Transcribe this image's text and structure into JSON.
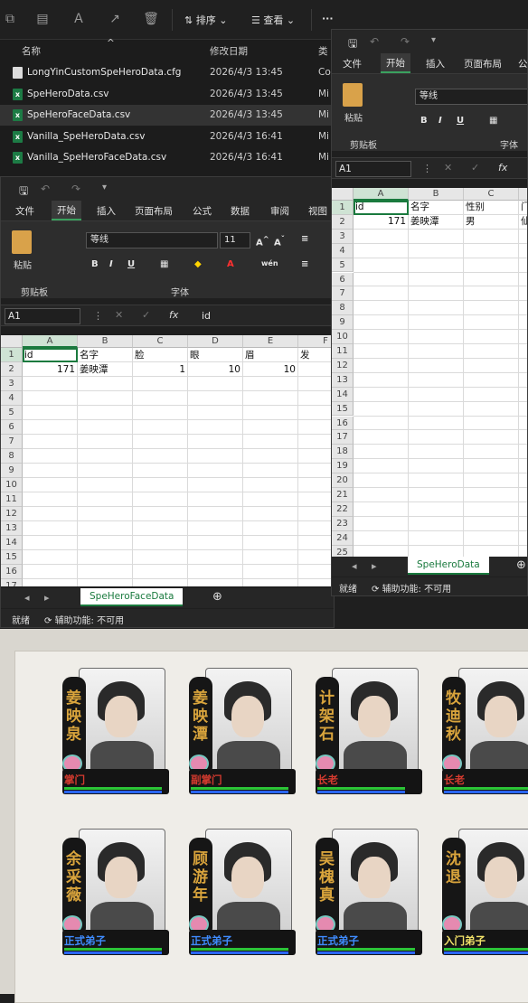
{
  "explorer": {
    "toolbar": {
      "sort_label": "排序",
      "view_label": "查看",
      "more_label": "···"
    },
    "columns": {
      "name": "名称",
      "date": "修改日期",
      "type": "类"
    },
    "files": [
      {
        "name": "LongYinCustomSpeHeroData.cfg",
        "date": "2026/4/3 13:45",
        "type": "Co",
        "kind": "cfg"
      },
      {
        "name": "SpeHeroData.csv",
        "date": "2026/4/3 13:45",
        "type": "Mi",
        "kind": "csv"
      },
      {
        "name": "SpeHeroFaceData.csv",
        "date": "2026/4/3 13:45",
        "type": "Mi",
        "kind": "csv",
        "selected": true
      },
      {
        "name": "Vanilla_SpeHeroData.csv",
        "date": "2026/4/3 16:41",
        "type": "Mi",
        "kind": "csv"
      },
      {
        "name": "Vanilla_SpeHeroFaceData.csv",
        "date": "2026/4/3 16:41",
        "type": "Mi",
        "kind": "csv"
      }
    ]
  },
  "excel_face": {
    "tabs": [
      "文件",
      "开始",
      "插入",
      "页面布局",
      "公式",
      "数据",
      "审阅",
      "视图"
    ],
    "active_tab": "开始",
    "ribbon": {
      "paste": "粘贴",
      "clipboard": "剪贴板",
      "font_name": "等线",
      "font_size": "11",
      "font_group": "字体"
    },
    "namebox": "A1",
    "formula": "id",
    "columns": [
      "A",
      "B",
      "C",
      "D",
      "E",
      "F"
    ],
    "rows": [
      "1",
      "2",
      "3",
      "4",
      "5",
      "6",
      "7",
      "8",
      "9",
      "10",
      "11",
      "12",
      "13",
      "14",
      "15",
      "16",
      "17"
    ],
    "cells": {
      "A1": "id",
      "B1": "名字",
      "C1": "脸",
      "D1": "眼",
      "E1": "眉",
      "F1": "发",
      "A2": "171",
      "B2": "姜映潭",
      "C2": "1",
      "D2": "10",
      "E2": "10"
    },
    "sheet_name": "SpeHeroFaceData",
    "status": {
      "ready": "就绪",
      "accessibility": "辅助功能: 不可用"
    }
  },
  "excel_data": {
    "tabs": [
      "文件",
      "开始",
      "插入",
      "页面布局",
      "公"
    ],
    "active_tab": "开始",
    "ribbon": {
      "paste": "粘贴",
      "clipboard": "剪贴板",
      "font_name": "等线",
      "font_group": "字体"
    },
    "namebox": "A1",
    "columns": [
      "A",
      "B",
      "C",
      "D"
    ],
    "rows": [
      "1",
      "2",
      "3",
      "4",
      "5",
      "6",
      "7",
      "8",
      "9",
      "10",
      "11",
      "12",
      "13",
      "14",
      "15",
      "16",
      "17",
      "18",
      "19",
      "20",
      "21",
      "22",
      "23",
      "24",
      "25"
    ],
    "cells": {
      "A1": "id",
      "B1": "名字",
      "C1": "性别",
      "D1": "门",
      "A2": "171",
      "B2": "姜映潭",
      "C2": "男",
      "D2": "仙"
    },
    "sheet_name": "SpeHeroData",
    "status": {
      "ready": "就绪",
      "accessibility": "辅助功能: 不可用"
    }
  },
  "game": {
    "cards": [
      {
        "name": "姜映泉",
        "rank": "掌门",
        "rank_color": "red",
        "green_bar": 0.95,
        "blue_bar": 0.95
      },
      {
        "name": "姜映潭",
        "rank": "副掌门",
        "rank_color": "red",
        "green_bar": 0.95,
        "blue_bar": 0.95
      },
      {
        "name": "计架石",
        "rank": "长老",
        "rank_color": "red",
        "green_bar": 0.85,
        "blue_bar": 0.85
      },
      {
        "name": "牧迪秋",
        "rank": "长老",
        "rank_color": "red",
        "green_bar": 0.9,
        "blue_bar": 0.9
      },
      {
        "name": "余采薇",
        "rank": "正式弟子",
        "rank_color": "blue",
        "green_bar": 0.95,
        "blue_bar": 0.95
      },
      {
        "name": "顾游年",
        "rank": "正式弟子",
        "rank_color": "blue",
        "green_bar": 0.95,
        "blue_bar": 0.95
      },
      {
        "name": "吴槐真",
        "rank": "正式弟子",
        "rank_color": "blue",
        "green_bar": 0.95,
        "blue_bar": 0.95
      },
      {
        "name": "沈退",
        "rank": "入门弟子",
        "rank_color": "yellow",
        "green_bar": 0.9,
        "blue_bar": 0.9
      }
    ]
  }
}
